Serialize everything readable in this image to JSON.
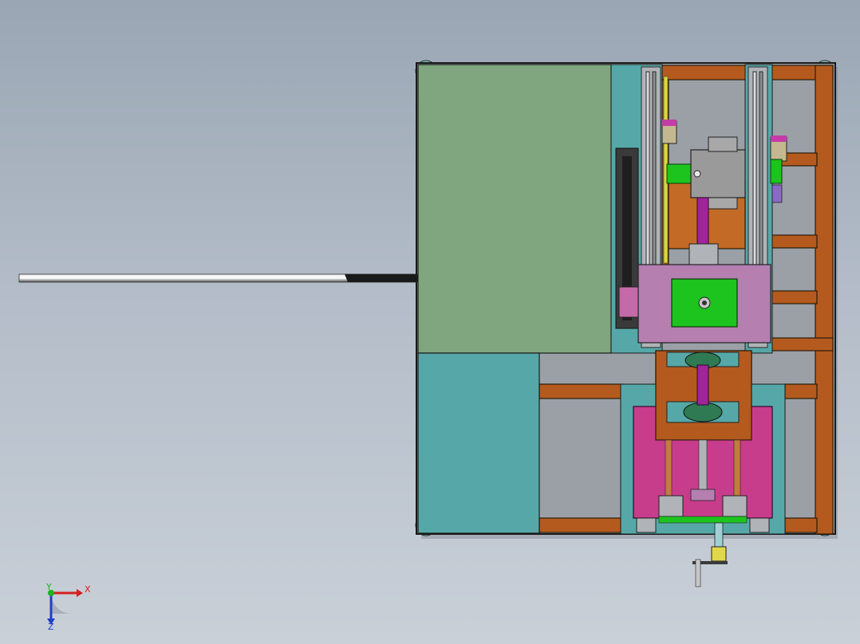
{
  "viewport": {
    "background_top": "#9aa6b4",
    "background_bottom": "#c9d0d8"
  },
  "colors": {
    "panel_green": "#7fa67e",
    "panel_teal": "#56a8a8",
    "frame_brown": "#b55a1e",
    "carriage_mauve": "#b57fb0",
    "plate_magenta": "#c83c8c",
    "block_green": "#1dc41d",
    "rail_grey": "#b0b4b8",
    "outline": "#1a1a1a"
  },
  "triad": {
    "x_label": "X",
    "y_label": "Y",
    "z_label": "Z"
  }
}
